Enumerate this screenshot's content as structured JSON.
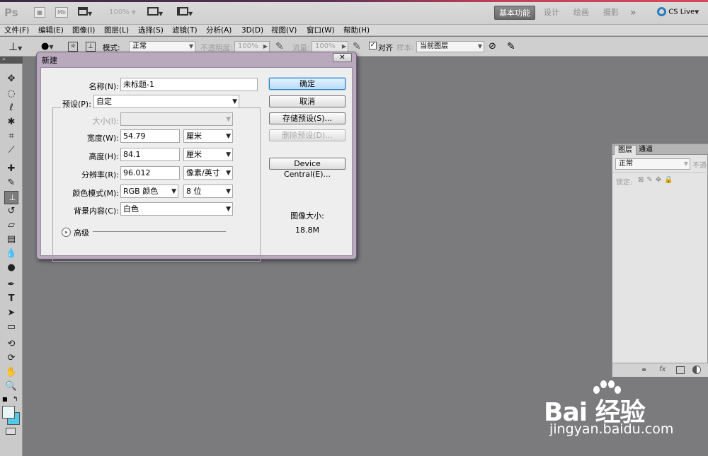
{
  "app": {
    "logo": "Ps",
    "toolbar_badges": [
      "Mb"
    ],
    "zoom": "100%",
    "workspaces": [
      "基本功能",
      "设计",
      "绘画",
      "摄影"
    ],
    "more": "»",
    "cslive": "CS Live"
  },
  "menubar": [
    "文件(F)",
    "编辑(E)",
    "图像(I)",
    "图层(L)",
    "选择(S)",
    "滤镜(T)",
    "分析(A)",
    "3D(D)",
    "视图(V)",
    "窗口(W)",
    "帮助(H)"
  ],
  "options": {
    "mode_label": "模式:",
    "mode_value": "正常",
    "opacity_label": "不透明度:",
    "opacity_value": "100%",
    "flow_label": "流量:",
    "flow_value": "100%",
    "align_label": "对齐",
    "align_checked": true,
    "sample_label": "样本:",
    "sample_value": "当前图层"
  },
  "dialog": {
    "title": "新建",
    "close": "✕",
    "name_label": "名称(N):",
    "name_value": "未标题-1",
    "preset_label": "预设(P):",
    "preset_value": "自定",
    "size_label": "大小(I):",
    "size_value": "",
    "width_label": "宽度(W):",
    "width_value": "54.79",
    "width_unit": "厘米",
    "height_label": "高度(H):",
    "height_value": "84.1",
    "height_unit": "厘米",
    "resolution_label": "分辨率(R):",
    "resolution_value": "96.012",
    "resolution_unit": "像素/英寸",
    "colormode_label": "颜色模式(M):",
    "colormode_value": "RGB 颜色",
    "colormode_bits": "8 位",
    "background_label": "背景内容(C):",
    "background_value": "白色",
    "advanced_label": "高级",
    "image_size_label": "图像大小:",
    "image_size_value": "18.8M",
    "buttons": {
      "ok": "确定",
      "cancel": "取消",
      "save_preset": "存储预设(S)...",
      "delete_preset": "删除预设(D)...",
      "device_central": "Device Central(E)..."
    }
  },
  "layers_panel": {
    "tabs": [
      "图层",
      "通道"
    ],
    "blend_mode": "正常",
    "opacity_label": "不透",
    "lock_label": "锁定:",
    "footer_icons": [
      "link-icon",
      "fx-icon",
      "mask-icon",
      "adjustment-icon"
    ],
    "footer_fx": "fx"
  },
  "watermark": {
    "main": "Bai 经验",
    "url": "jingyan.baidu.com"
  },
  "colors": {
    "canvas": "#7b7b7e",
    "dialog_frame": "#b8a9bd",
    "primary_button": "#b8dcf6",
    "foreground_swatch": "#e8f6f8",
    "background_swatch": "#54c8e6"
  }
}
